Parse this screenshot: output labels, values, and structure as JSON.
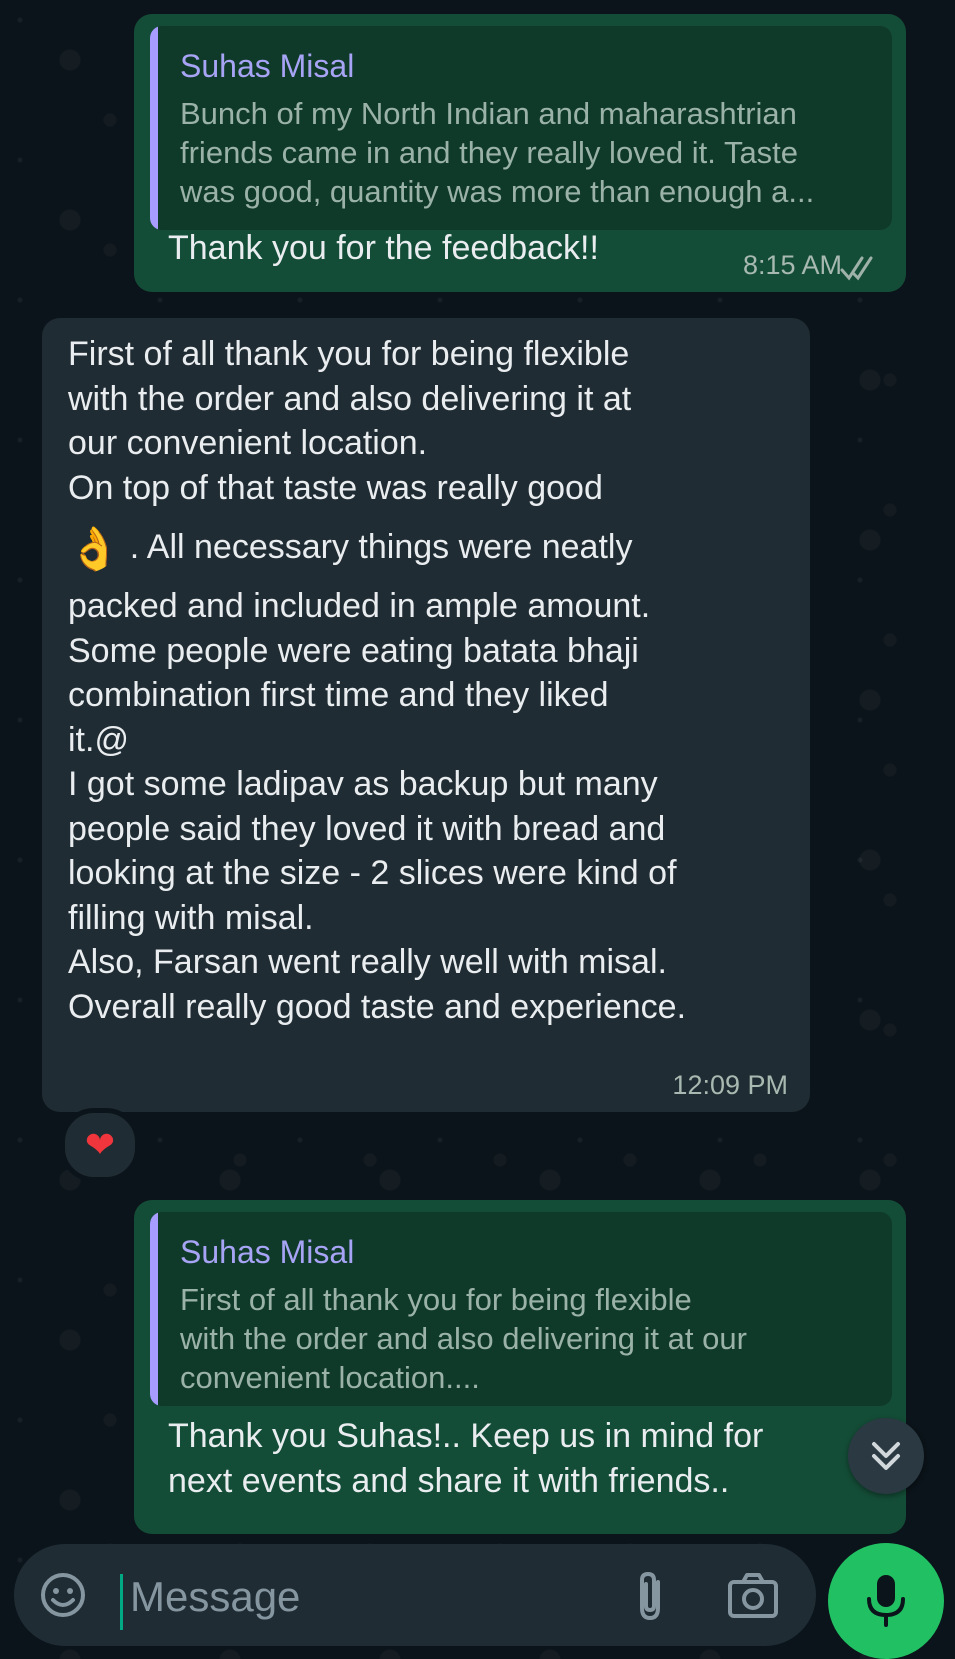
{
  "colors": {
    "background": "#0b141a",
    "outgoing_bubble": "#144d37",
    "incoming_bubble": "#202c33",
    "quote_bar": "#a79cff",
    "accent_green": "#21c063"
  },
  "messages": [
    {
      "direction": "outgoing",
      "quote": {
        "author": "Suhas Misal",
        "text": "Bunch of my North Indian and maharashtrian\nfriends came in and they really loved it. Taste\nwas good, quantity was more than enough a..."
      },
      "text": "Thank you for the feedback!!",
      "time": "8:15 AM",
      "status": "read"
    },
    {
      "direction": "incoming",
      "text_a": "First of all thank you for being flexible\nwith the order and also delivering it at\nour convenient location.\nOn top of that taste was really good",
      "emoji": "👌",
      "text_b": ". All necessary things were neatly",
      "text_c": "packed and included in ample amount.\nSome people were eating batata bhaji\ncombination first time and they liked\nit.@\nI got some ladipav as backup but many\npeople said they loved it with bread and\nlooking at the size - 2 slices were kind of\nfilling with misal.\nAlso, Farsan went really well with misal.\nOverall really good taste and experience.",
      "time": "12:09 PM",
      "reaction": "❤"
    },
    {
      "direction": "outgoing",
      "quote": {
        "author": "Suhas Misal",
        "text": "First of all thank you for being flexible\nwith the order and also delivering it at our\nconvenient location...."
      },
      "text": "Thank you Suhas!.. Keep us in mind for\nnext events and share it with friends.."
    }
  ],
  "composer": {
    "placeholder": "Message",
    "emoji_icon": "sticker-emoji-icon",
    "attach_icon": "paperclip-icon",
    "camera_icon": "camera-icon",
    "send_icon": "microphone-icon"
  },
  "scroll_button_icon": "double-chevron-down-icon"
}
